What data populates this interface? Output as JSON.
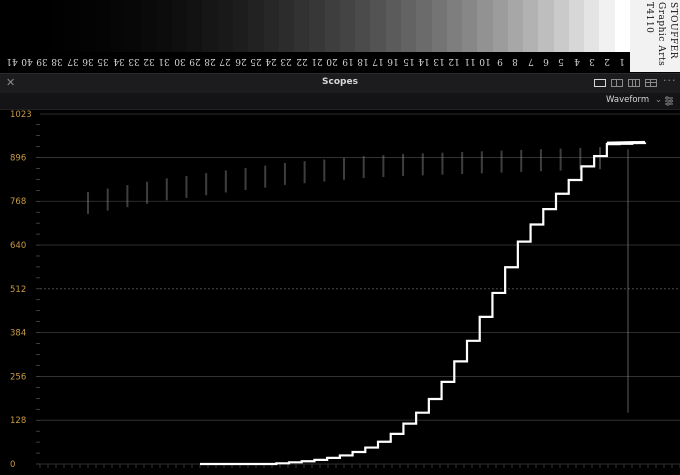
{
  "stepwedge": {
    "numbers": [
      "41",
      "40",
      "39",
      "38",
      "37",
      "36",
      "35",
      "34",
      "33",
      "32",
      "31",
      "30",
      "29",
      "28",
      "27",
      "26",
      "25",
      "24",
      "23",
      "22",
      "21",
      "20",
      "19",
      "18",
      "17",
      "16",
      "15",
      "14",
      "13",
      "12",
      "11",
      "10",
      "9",
      "8",
      "7",
      "6",
      "5",
      "4",
      "3",
      "2",
      "1"
    ],
    "brand_lines": [
      "STOUFFER",
      "Graphic Arts",
      "T4110"
    ]
  },
  "panel": {
    "title": "Scopes",
    "close_icon": "close-icon",
    "layout_icons": [
      "single-view-icon",
      "dual-view-icon",
      "triple-view-icon",
      "quad-view-icon"
    ],
    "more_icon": "more-options-icon"
  },
  "toolbar": {
    "scope_type": "Waveform",
    "dropdown_icon": "chevron-down-icon",
    "settings_icon": "settings-sliders-icon"
  },
  "chart_data": {
    "type": "waveform",
    "ylim": [
      0,
      1023
    ],
    "y_ticks": [
      "1023",
      "896",
      "768",
      "640",
      "512",
      "384",
      "256",
      "128",
      "0"
    ],
    "grid": true,
    "series": [
      {
        "x": [
          0,
          4,
          8,
          12,
          16,
          20,
          24,
          28,
          32,
          36,
          40,
          44,
          48,
          52,
          56,
          60,
          64,
          68,
          72,
          76,
          80,
          84,
          88,
          92,
          96,
          100
        ],
        "values": [
          0,
          0,
          0,
          0,
          0,
          0,
          2,
          5,
          8,
          12,
          18,
          25,
          35,
          48,
          65,
          88,
          118,
          150,
          190,
          240,
          300,
          360,
          430,
          500,
          575,
          640
        ]
      },
      {
        "x": [
          100,
          104,
          108,
          112,
          116,
          120,
          124,
          128,
          132,
          136,
          140
        ],
        "values": [
          650,
          700,
          745,
          790,
          830,
          870,
          900,
          935,
          936,
          938,
          940
        ]
      }
    ],
    "upper_trace_values": [
      795,
      805,
      815,
      825,
      835,
      842,
      850,
      858,
      865,
      872,
      880,
      885,
      890,
      895,
      900,
      903,
      906,
      908,
      910,
      912,
      914,
      916,
      918,
      920,
      922,
      924,
      926
    ]
  }
}
